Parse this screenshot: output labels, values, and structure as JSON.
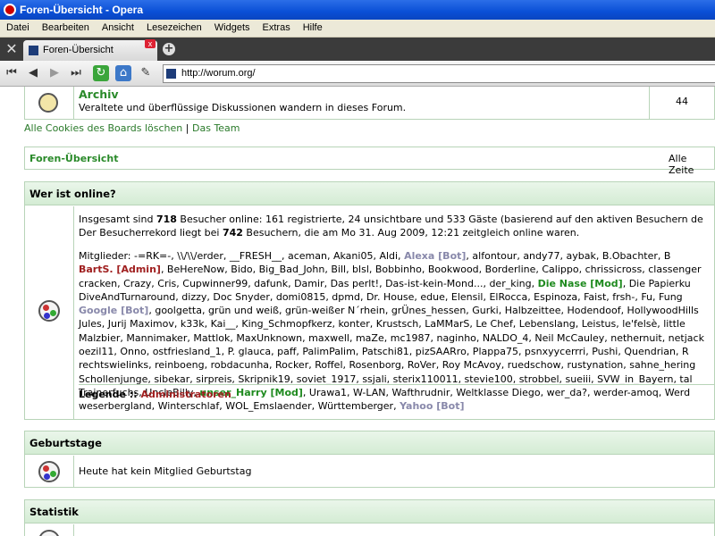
{
  "window": {
    "title": "Foren-Übersicht - Opera"
  },
  "menu": [
    "Datei",
    "Bearbeiten",
    "Ansicht",
    "Lesezeichen",
    "Widgets",
    "Extras",
    "Hilfe"
  ],
  "tab": {
    "label": "Foren-Übersicht",
    "close": "x"
  },
  "address": {
    "url": "http://worum.org/"
  },
  "archiv": {
    "title": "Archiv",
    "desc": "Veraltete und überflüssige Diskussionen wandern in dieses Forum.",
    "count": "44"
  },
  "links": {
    "cookies": "Alle Cookies des Boards löschen",
    "sep": "|",
    "team": "Das Team"
  },
  "breadcrumb": {
    "label": "Foren-Übersicht",
    "right": "Alle Zeite"
  },
  "online": {
    "header": "Wer ist online?",
    "line1_pre": "Insgesamt sind ",
    "total": "718",
    "line1_post": " Besucher online: 161 registrierte, 24 unsichtbare und 533 Gäste (basierend auf den aktiven Besuchern de",
    "line2_pre": "Der Besucherrekord liegt bei ",
    "record": "742",
    "line2_post": " Besuchern, die am Mo 31. Aug 2009, 12:21 zeitgleich online waren.",
    "members_label": "Mitglieder: ",
    "lines": [
      [
        [
          "-=RK=-, \\\\/\\\\/erder, __FRESH__, aceman, Akani05, Aldi, ",
          "n"
        ],
        [
          "Alexa [Bot]",
          "b"
        ],
        [
          ", alfontour, andy77, aybak, B.Obachter, B",
          "n"
        ]
      ],
      [
        [
          "BartS. [Admin]",
          "r"
        ],
        [
          ", BeHereNow, Bido, Big_Bad_John, Bill, blsl, Bobbinho, Bookwood, Borderline, Calippo, chrissicross, classenger",
          "n"
        ]
      ],
      [
        [
          "cracken, Crazy, Cris, Cupwinner99, dafunk, Damir, Das perlt!, Das-ist-kein-Mond..., der_king, ",
          "n"
        ],
        [
          "Die Nase [Mod]",
          "m"
        ],
        [
          ", Die Papierku",
          "n"
        ]
      ],
      [
        [
          "DiveAndTurnaround, dizzy, Doc Snyder, domi0815, dpmd, Dr. House, edue, Elensil, ElRocca, Espinoza, Faist, frsh-, Fu, Fung",
          "n"
        ]
      ],
      [
        [
          "Google [Bot]",
          "b"
        ],
        [
          ", goolgetta, grün und weiß, grün-weißer N´rhein, grÜnes_hessen, Gurki, Halbzeittee, Hodendoof, HollywoodHills",
          "n"
        ]
      ],
      [
        [
          "Jules, Jurij Maximov, k33k, Kai__, King_Schmopfkerz, konter, Krustsch, LaMMarS, Le Chef, Lebenslang, Leistus, le'felsè, little",
          "n"
        ]
      ],
      [
        [
          "Malzbier, Mannimaker, Mattlok, MaxUnknown, maxwell, maZe, mc1987, naginho, NALDO_4, Neil McCauley, nethernuit, netjack",
          "n"
        ]
      ],
      [
        [
          "oezil11, Onno, ostfriesland_1, P. glauca, paff, PalimPalim, Patschi81, pizSAARro, Plappa75, psnxyycerrri, Pushi, Quendrian, R",
          "n"
        ]
      ],
      [
        [
          "rechtswielinks, reinboeng, robdacunha, Rocker, Roffel, Rosenborg, RoVer, Roy McAvoy, ruedschow, rustynation, sahne_hering",
          "n"
        ]
      ],
      [
        [
          "Schollenjunge, sibekar, sirpreis, Skripnik19, soviet_1917, ssjali, sterix110011, stevie100, strobbel, sueiii, SVW_in_Bayern, tal",
          "n"
        ]
      ],
      [
        [
          "Trainerfuchs, UncleBilly, ",
          "n"
        ],
        [
          "unser_Harry [Mod]",
          "m"
        ],
        [
          ", Urawa1, W-LAN, Wafthrudnir, Weltklasse Diego, wer_da?, werder-amoq, Werd",
          "n"
        ]
      ],
      [
        [
          "weserbergland, Winterschlaf, WOL_Emslaender, Württemberger, ",
          "n"
        ],
        [
          "Yahoo [Bot]",
          "b"
        ]
      ]
    ],
    "legend_label": "Legende :: ",
    "legend_admin": "Administratoren"
  },
  "birthdays": {
    "header": "Geburtstage",
    "text": "Heute hat kein Mitglied Geburtstag"
  },
  "stats": {
    "header": "Statistik"
  }
}
